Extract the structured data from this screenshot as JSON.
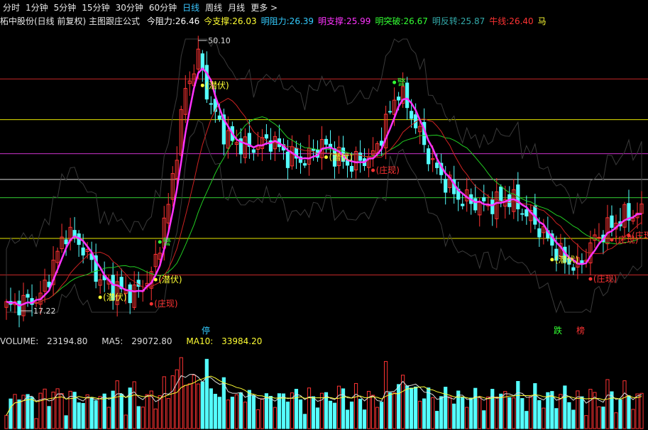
{
  "tabs": [
    {
      "label": "分时",
      "active": false
    },
    {
      "label": "1分钟",
      "active": false
    },
    {
      "label": "5分钟",
      "active": false
    },
    {
      "label": "15分钟",
      "active": false
    },
    {
      "label": "30分钟",
      "active": false
    },
    {
      "label": "60分钟",
      "active": false
    },
    {
      "label": "日线",
      "active": true
    },
    {
      "label": "周线",
      "active": false
    },
    {
      "label": "月线",
      "active": false
    },
    {
      "label": "更多 >",
      "active": false
    }
  ],
  "title": "柘中股份(日线 前复权) 主图跟庄公式",
  "indicators": [
    {
      "label": "今阻力:",
      "value": "26.46",
      "color": "#ffffff"
    },
    {
      "label": "今支撑:",
      "value": "26.03",
      "color": "#ffff33"
    },
    {
      "label": "明阻力:",
      "value": "26.39",
      "color": "#33ccff"
    },
    {
      "label": "明支撑:",
      "value": "25.99",
      "color": "#ff33ff"
    },
    {
      "label": "明突破:",
      "value": "26.67",
      "color": "#33ff33"
    },
    {
      "label": "明反转:",
      "value": "25.87",
      "color": "#33aaaa"
    },
    {
      "label": "牛线:",
      "value": "26.40",
      "color": "#ff3333"
    },
    {
      "label": "马",
      "value": "",
      "color": "#ffff33"
    }
  ],
  "chart_data": {
    "type": "candlestick",
    "price_high_label": "50.10",
    "price_low_label": "17.22",
    "price_range": [
      17.22,
      50.1
    ],
    "horizontal_levels": [
      {
        "price": 45.3,
        "color": "#c62828"
      },
      {
        "price": 40.4,
        "color": "#e6e600"
      },
      {
        "price": 36.3,
        "color": "#cc33cc"
      },
      {
        "price": 33.2,
        "color": "#dddddd"
      },
      {
        "price": 31.0,
        "color": "#33cc33"
      },
      {
        "price": 26.1,
        "color": "#e6e600"
      },
      {
        "price": 21.7,
        "color": "#c62828"
      }
    ],
    "annotations": [
      {
        "text": "(潜伏)",
        "color": "#ffff33"
      },
      {
        "text": "(潜伏)",
        "color": "#ffff33"
      },
      {
        "text": "(潜伏)",
        "color": "#ffff33"
      },
      {
        "text": "(潜伏)",
        "color": "#ffff33"
      },
      {
        "text": "(潜伏)",
        "color": "#ffff33"
      },
      {
        "text": "(庄现)",
        "color": "#ff3333"
      },
      {
        "text": "(庄现)",
        "color": "#ff3333"
      },
      {
        "text": "(庄现)",
        "color": "#ff3333"
      },
      {
        "text": "(庄现)",
        "color": "#ff3333"
      },
      {
        "text": "(庄现)",
        "color": "#ff3333"
      },
      {
        "text": "警",
        "color": "#33ff33"
      },
      {
        "text": "警",
        "color": "#33ff33"
      }
    ],
    "bottom_markers": [
      {
        "text": "停",
        "color": "#33ccff"
      },
      {
        "text": "跌",
        "color": "#33ff33"
      },
      {
        "text": "榜",
        "color": "#ff3333"
      }
    ]
  },
  "volume": {
    "label": "VOLUME:",
    "value": "23194.80",
    "ma5_label": "MA5:",
    "ma5_value": "29072.80",
    "ma10_label": "MA10:",
    "ma10_value": "33984.20"
  },
  "colors": {
    "up": "#ff3333",
    "down": "#54ffff",
    "ma_pink": "#ff33ff",
    "ma_red": "#cc2222",
    "ma_green": "#22cc22",
    "band": "#3a3a3a"
  }
}
